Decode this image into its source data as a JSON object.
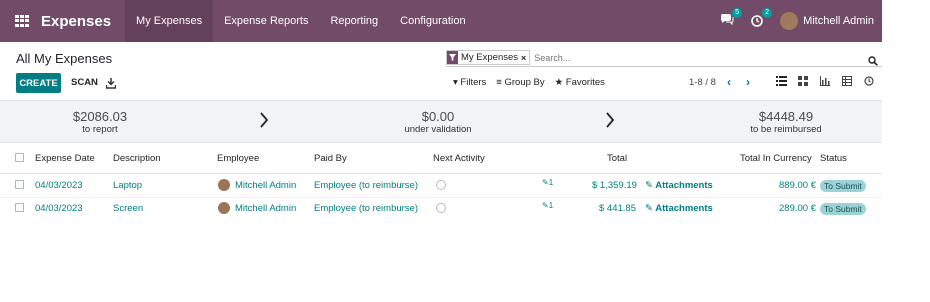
{
  "navbar": {
    "app_name": "Expenses",
    "menu": [
      "My Expenses",
      "Expense Reports",
      "Reporting",
      "Configuration"
    ],
    "messages_count": "5",
    "activities_count": "2",
    "user_name": "Mitchell Admin"
  },
  "control_panel": {
    "title": "All My Expenses",
    "facet_label": "My Expenses",
    "facet_remove": "×",
    "search_placeholder": "Search...",
    "create_label": "CREATE",
    "scan_label": "SCAN",
    "filters_label": "Filters",
    "group_by_label": "Group By",
    "favorites_label": "Favorites",
    "pager": "1-8 / 8"
  },
  "summary": {
    "to_report": {
      "amount": "$2086.03",
      "label": "to report"
    },
    "under_validation": {
      "amount": "$0.00",
      "label": "under validation"
    },
    "to_be_reimbursed": {
      "amount": "$4448.49",
      "label": "to be reimbursed"
    }
  },
  "table": {
    "headers": {
      "date": "Expense Date",
      "description": "Description",
      "employee": "Employee",
      "paid_by": "Paid By",
      "next_activity": "Next Activity",
      "total": "Total",
      "total_currency": "Total In Currency",
      "status": "Status"
    },
    "rows": [
      {
        "date": "04/03/2023",
        "description": "Laptop",
        "employee": "Mitchell Admin",
        "paid_by": "Employee (to reimburse)",
        "attachments_count": "1",
        "total": "$ 1,359.19",
        "attachments_label": "Attachments",
        "total_currency": "889.00 €",
        "status": "To Submit"
      },
      {
        "date": "04/03/2023",
        "description": "Screen",
        "employee": "Mitchell Admin",
        "paid_by": "Employee (to reimburse)",
        "attachments_count": "1",
        "total": "$ 441.85",
        "attachments_label": "Attachments",
        "total_currency": "289.00 €",
        "status": "To Submit"
      }
    ]
  },
  "colors": {
    "navbar": "#714B67",
    "primary": "#017E84",
    "status_badge": "#9ad3d6"
  }
}
